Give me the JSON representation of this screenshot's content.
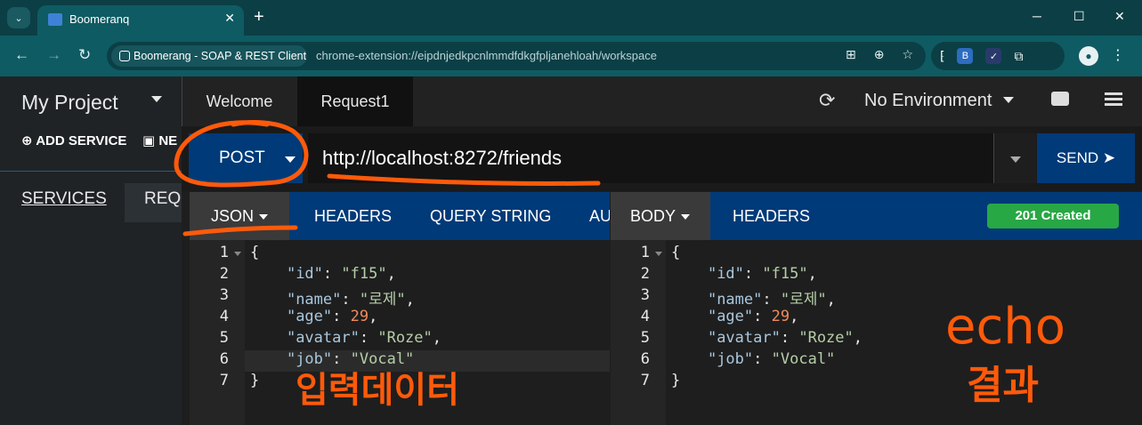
{
  "browser": {
    "tab_title": "Boomeranq",
    "site_chip": "Boomerang - SOAP & REST Client",
    "url": "chrome-extension://eipdnjedkpcnlmmdfdkgfpljanehloah/workspace",
    "minimize": "─",
    "maximize": "☐",
    "close": "✕"
  },
  "sidebar": {
    "project": "My Project",
    "add_service": "ADD SERVICE",
    "add_new": "NE",
    "tab_services": "SERVICES",
    "tab_requests": "REQU"
  },
  "topbar": {
    "tabs": [
      "Welcome",
      "Request1"
    ],
    "environment": "No Environment"
  },
  "request": {
    "method": "POST",
    "url": "http://localhost:8272/friends",
    "send": "SEND ➤",
    "tabs": [
      "JSON",
      "HEADERS",
      "QUERY STRING",
      "AU"
    ]
  },
  "response": {
    "tabs": [
      "BODY",
      "HEADERS"
    ],
    "status": "201 Created"
  },
  "code": {
    "line_numbers": [
      "1",
      "2",
      "3",
      "4",
      "5",
      "6",
      "7"
    ],
    "request_lines": [
      "{",
      "    \"id\": \"f15\",",
      "    \"name\": \"로제\",",
      "    \"age\": 29,",
      "    \"avatar\": \"Roze\",",
      "    \"job\": \"Vocal\"",
      "}"
    ],
    "response_lines": [
      "{",
      "    \"id\": \"f15\",",
      "    \"name\": \"로제\",",
      "    \"age\": 29,",
      "    \"avatar\": \"Roze\",",
      "    \"job\": \"Vocal\"",
      "}"
    ]
  },
  "annotations": {
    "input_label": "입력데이터",
    "echo_label": "echo",
    "result_label": "결과",
    "color": "#ff5a0a"
  }
}
